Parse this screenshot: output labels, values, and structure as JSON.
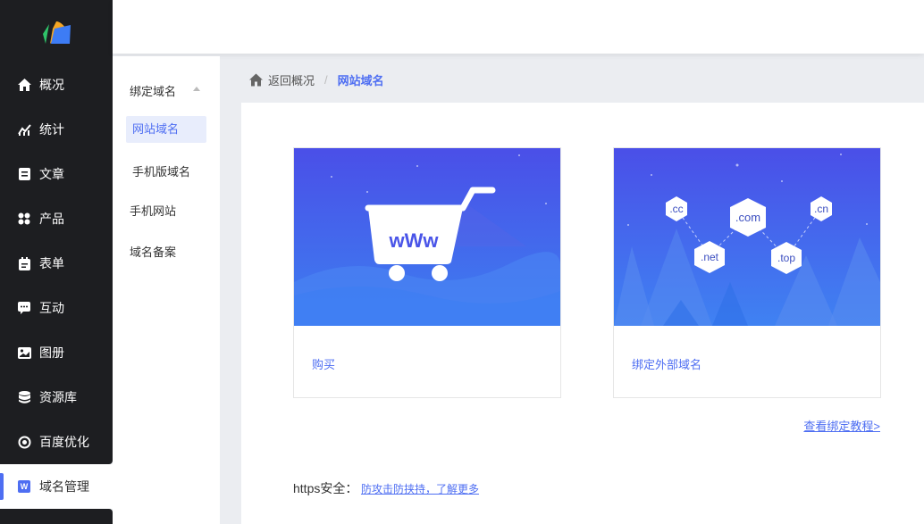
{
  "sidebar": {
    "items": [
      {
        "label": "概况",
        "icon": "home-icon"
      },
      {
        "label": "统计",
        "icon": "stats-icon"
      },
      {
        "label": "文章",
        "icon": "article-icon"
      },
      {
        "label": "产品",
        "icon": "product-icon"
      },
      {
        "label": "表单",
        "icon": "form-icon"
      },
      {
        "label": "互动",
        "icon": "chat-icon"
      },
      {
        "label": "图册",
        "icon": "gallery-icon"
      },
      {
        "label": "资源库",
        "icon": "database-icon"
      },
      {
        "label": "百度优化",
        "icon": "seo-icon"
      },
      {
        "label": "域名管理",
        "icon": "domain-icon",
        "badge": "W"
      }
    ]
  },
  "submenu": {
    "group": "绑定域名",
    "items": [
      "网站域名",
      "手机版域名"
    ],
    "extra": [
      "手机网站",
      "域名备案"
    ]
  },
  "breadcrumb": {
    "back": "返回概况",
    "separator": "/",
    "current": "网站域名"
  },
  "cards": {
    "buy": {
      "label": "购买",
      "banner_text": "wWw"
    },
    "bind": {
      "label": "绑定外部域名",
      "tlds": [
        ".cc",
        ".com",
        ".cn",
        ".net",
        ".top"
      ]
    }
  },
  "tutorial_link": "查看绑定教程>",
  "https": {
    "label": "https安全：",
    "link": "防攻击防挟持，了解更多"
  },
  "colors": {
    "accent": "#4e6ef2",
    "sidebar_bg": "#1d1e21"
  }
}
